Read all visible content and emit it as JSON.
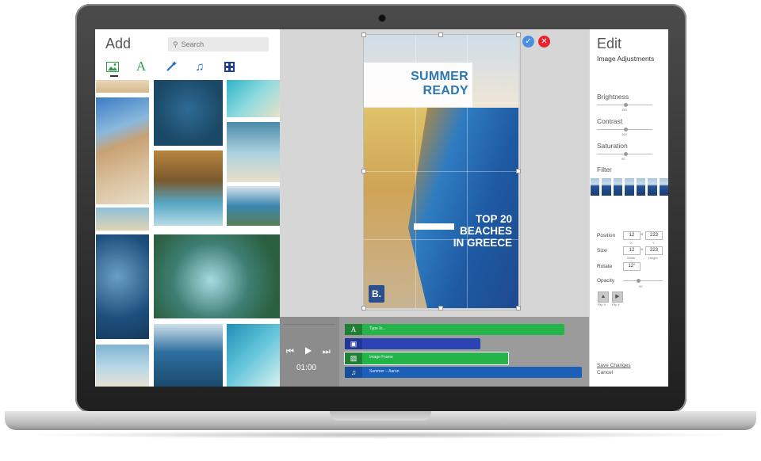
{
  "left_panel": {
    "title": "Add",
    "search_placeholder": "Search",
    "tools": [
      "image-icon",
      "text-icon",
      "magic-wand-icon",
      "music-note-icon",
      "layout-icon"
    ],
    "tool_colors": [
      "#2e9e44",
      "#2e9e44",
      "#1a6fc4",
      "#1a6fc4",
      "#1f3f8f"
    ]
  },
  "canvas": {
    "headline_line1": "SUMMER",
    "headline_line2": "READY",
    "subhead_line1": "TOP 20",
    "subhead_line2": "BEACHES",
    "subhead_line3": "IN GREECE",
    "logo": "B.",
    "confirm_icon": "✓",
    "cancel_icon": "✕"
  },
  "timeline": {
    "controls": "⏮ ▶ ⏭",
    "time": "01:00",
    "tracks": [
      {
        "icon": "A",
        "label": "Type In...",
        "color": "#25b44a"
      },
      {
        "icon": "▣",
        "label": "",
        "color": "#2c44b3"
      },
      {
        "icon": "▨",
        "label": "Image Frame",
        "color": "#25b44a"
      },
      {
        "icon": "♫",
        "label": "Summer – Aaron",
        "color": "#1a5fb8"
      }
    ]
  },
  "right_panel": {
    "title": "Edit",
    "subtitle": "Image Adjustments",
    "brightness_label": "Brightness",
    "brightness_value": "150",
    "brightness_level": 0.52,
    "contrast_label": "Contrast",
    "contrast_value": "100",
    "contrast_level": 0.52,
    "saturation_label": "Saturation",
    "saturation_value": "90",
    "saturation_level": 0.52,
    "filter_label": "Filter",
    "position_label": "Position",
    "position_x": "12",
    "position_y": "223",
    "size_label": "Size",
    "size_w": "12",
    "size_h": "223",
    "width_label": "Width",
    "height_label": "Height",
    "x_label": "X",
    "y_label": "Y",
    "times": "×",
    "rotate_label": "Rotate",
    "rotate_value": "12°",
    "opacity_label": "Opacity",
    "opacity_value": "90",
    "opacity_level": 0.38,
    "flip_x_label": "Flip X",
    "flip_y_label": "Flip Y",
    "save_label": "Save Changes",
    "cancel_label": "Cancel"
  }
}
